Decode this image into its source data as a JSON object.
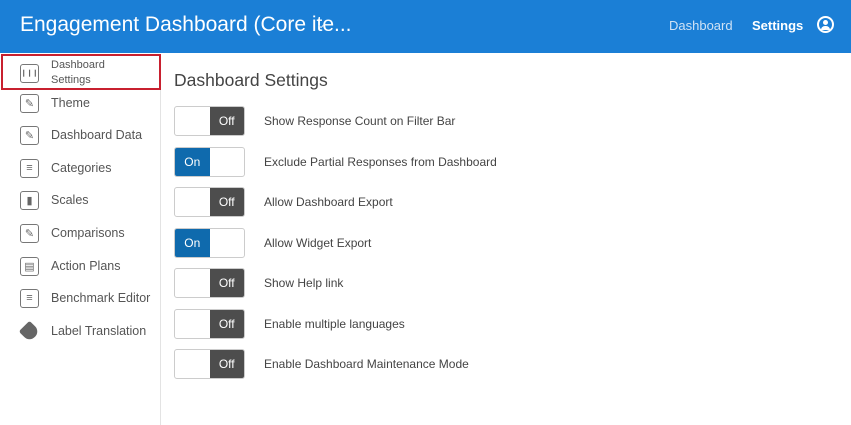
{
  "header": {
    "title": "Engagement Dashboard (Core ite...",
    "nav": [
      "Dashboard",
      "Settings"
    ]
  },
  "sidebar": {
    "items": [
      {
        "label": "Dashboard Settings",
        "icon": "sliders-icon"
      },
      {
        "label": "Theme",
        "icon": "brush-icon"
      },
      {
        "label": "Dashboard Data",
        "icon": "pencil-icon"
      },
      {
        "label": "Categories",
        "icon": "list-icon"
      },
      {
        "label": "Scales",
        "icon": "bar-chart-icon"
      },
      {
        "label": "Comparisons",
        "icon": "pencil-icon"
      },
      {
        "label": "Action Plans",
        "icon": "clipboard-icon"
      },
      {
        "label": "Benchmark Editor",
        "icon": "list-icon"
      },
      {
        "label": "Label Translation",
        "icon": "tag-icon"
      }
    ]
  },
  "main": {
    "title": "Dashboard Settings",
    "on_label": "On",
    "off_label": "Off",
    "settings": [
      {
        "label": "Show Response Count on Filter Bar",
        "on": false
      },
      {
        "label": "Exclude Partial Responses from Dashboard",
        "on": true
      },
      {
        "label": "Allow Dashboard Export",
        "on": false
      },
      {
        "label": "Allow Widget Export",
        "on": true
      },
      {
        "label": "Show Help link",
        "on": false
      },
      {
        "label": "Enable multiple languages",
        "on": false
      },
      {
        "label": "Enable Dashboard Maintenance Mode",
        "on": false
      }
    ]
  }
}
